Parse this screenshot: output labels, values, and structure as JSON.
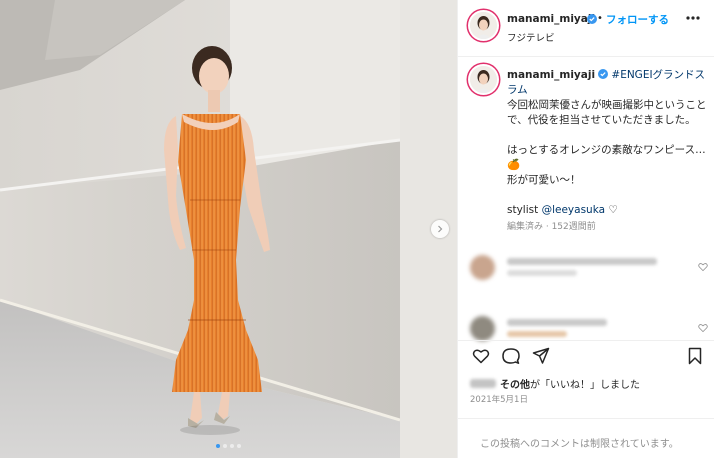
{
  "post": {
    "username": "manami_miyaji",
    "separator": "•",
    "follow_label": "フォローする",
    "location": "フジテレビ"
  },
  "caption": {
    "username": "manami_miyaji",
    "hashtag": "#ENGEIグランドスラム",
    "line1": "今回松岡茉優さんが映画撮影中ということで、代役を担当させていただきました。",
    "line2": "はっとするオレンジの素敵なワンピース…🍊",
    "line3": "形が可愛い〜！",
    "stylist_label": "stylist",
    "stylist_mention": "@leeyasuka",
    "stylist_emoji": "♡",
    "meta": "編集済み · 152週間前"
  },
  "likes": {
    "suffix_bold": "その他",
    "suffix": "が「いいね！」しました"
  },
  "date": "2021年5月1日",
  "comments_restricted": "この投稿へのコメントは制限されています。",
  "colors": {
    "accent_blue": "#0095f6",
    "verified_blue": "#3897f0",
    "dress_orange": "#f08a2e"
  },
  "icons": [
    "verified-icon",
    "more-icon",
    "heart-icon",
    "comment-icon",
    "share-icon",
    "bookmark-icon",
    "chevron-right-icon"
  ]
}
